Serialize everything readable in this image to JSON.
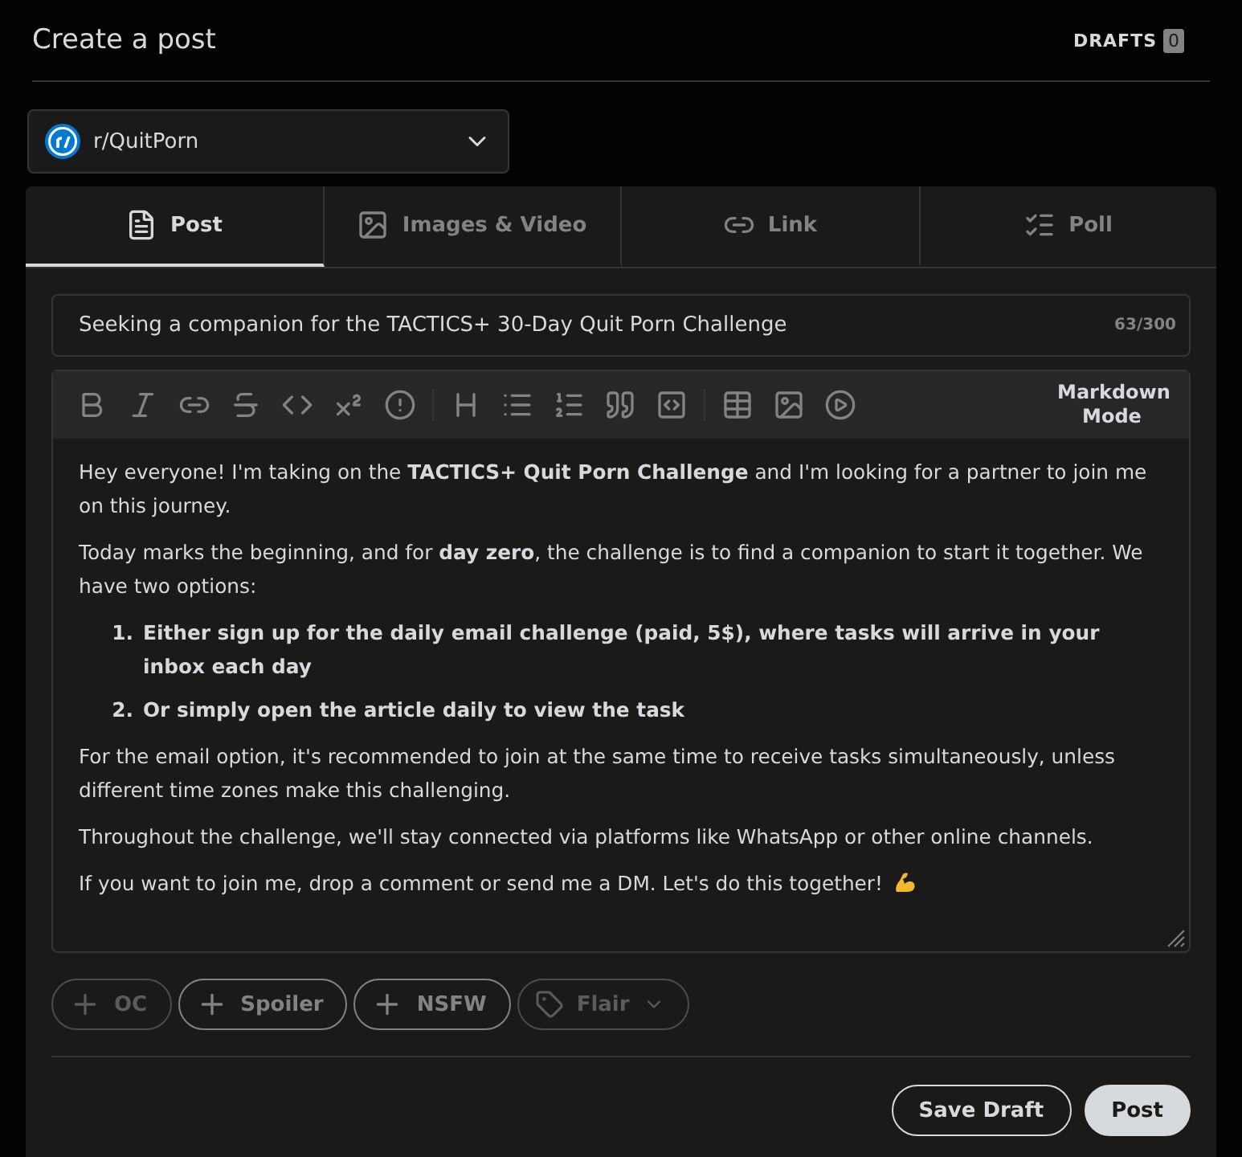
{
  "header": {
    "title": "Create a post",
    "drafts_label": "DRAFTS",
    "drafts_count": "0"
  },
  "community": {
    "name": "r/QuitPorn"
  },
  "tabs": [
    {
      "label": "Post",
      "selected": true
    },
    {
      "label": "Images & Video",
      "selected": false
    },
    {
      "label": "Link",
      "selected": false
    },
    {
      "label": "Poll",
      "selected": false
    }
  ],
  "title_field": {
    "value": "Seeking a companion for the TACTICS+ 30-Day Quit Porn Challenge",
    "counter": "63/300"
  },
  "editor": {
    "markdown_button": "Markdown Mode",
    "blocks": [
      {
        "kind": "p",
        "text": "Hey everyone! I'm taking on the **TACTICS+ Quit Porn Challenge** and I'm looking for a partner to join me on this journey."
      },
      {
        "kind": "p",
        "text": "Today marks the beginning, and for **day zero**, the challenge is to find a companion to start it together. We have two options:"
      },
      {
        "kind": "ol",
        "items": [
          {
            "marker": "1.",
            "text": "Either sign up for the daily email challenge (paid, 5$), where tasks will arrive in your inbox each day"
          },
          {
            "marker": "2.",
            "text": "Or simply open the article daily to view the task"
          }
        ]
      },
      {
        "kind": "p",
        "text": "For the email option, it's recommended to join at the same time to receive tasks simultaneously, unless different time zones make this challenging."
      },
      {
        "kind": "p",
        "text": "Throughout the challenge, we'll stay connected via platforms like WhatsApp or other online channels."
      },
      {
        "kind": "p",
        "text": "If you want to join me, drop a comment or send me a DM. Let's do this together!",
        "emoji": true
      }
    ]
  },
  "tags": [
    {
      "label": "OC",
      "kind": "toggle",
      "disabled": true
    },
    {
      "label": "Spoiler",
      "kind": "toggle",
      "disabled": false
    },
    {
      "label": "NSFW",
      "kind": "toggle",
      "disabled": false
    },
    {
      "label": "Flair",
      "kind": "dropdown",
      "disabled": true
    }
  ],
  "buttons": [
    {
      "label": "Save Draft",
      "kind": "outline"
    },
    {
      "label": "Post",
      "kind": "filled"
    }
  ]
}
